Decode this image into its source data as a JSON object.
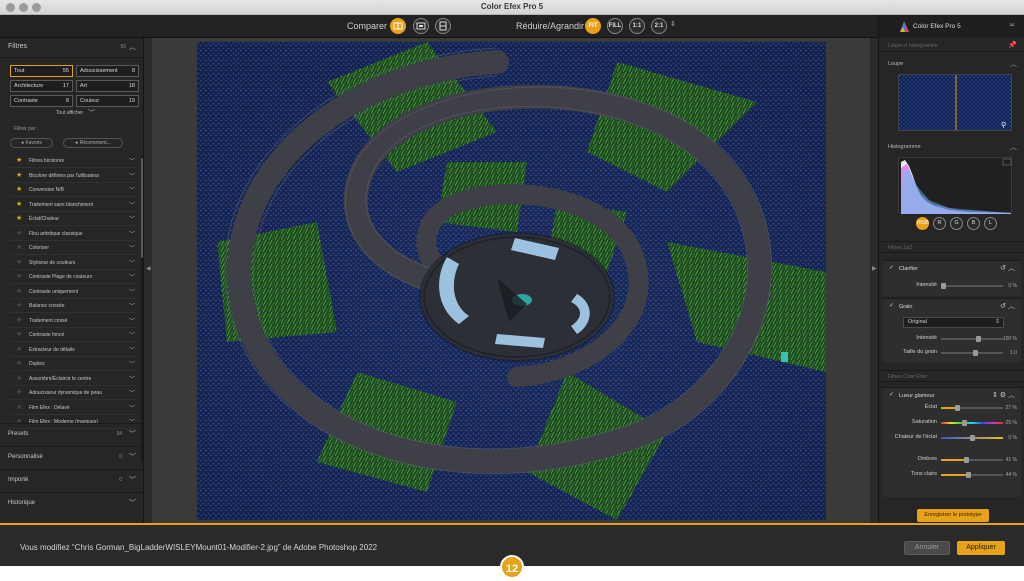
{
  "window": {
    "title": "Color Efex Pro 5"
  },
  "toolbar": {
    "compare_label": "Comparer",
    "resize_label": "Réduire/Agrandir",
    "zoom_buttons": [
      "FIT",
      "FILL",
      "1:1",
      "2:1"
    ]
  },
  "left_panel": {
    "filters": {
      "title": "Filtres",
      "count": "55",
      "categories": [
        {
          "label": "Tout",
          "count": "55"
        },
        {
          "label": "Adoucissement",
          "count": "8"
        },
        {
          "label": "Architecture",
          "count": "17"
        },
        {
          "label": "Art",
          "count": "18"
        },
        {
          "label": "Contraste",
          "count": "8"
        },
        {
          "label": "Couleur",
          "count": "19"
        }
      ],
      "show_all": "Tout afficher",
      "filter_by": "Filtrer par :",
      "favorites": "Favoris",
      "recent": "Récemment...",
      "items": [
        {
          "label": "Filtres bicolores",
          "favorite": true
        },
        {
          "label": "Bicolore définies par l'utilisateur",
          "favorite": true
        },
        {
          "label": "Conversion N/B",
          "favorite": true
        },
        {
          "label": "Traitement sans blanchiment",
          "favorite": true
        },
        {
          "label": "Éclat/Chaleur",
          "favorite": true
        },
        {
          "label": "Flou artistique classique",
          "favorite": false
        },
        {
          "label": "Coloriser",
          "favorite": false
        },
        {
          "label": "Styliseur de couleurs",
          "favorite": false
        },
        {
          "label": "Contraste Plage de couleurs",
          "favorite": false
        },
        {
          "label": "Contraste uniquement",
          "favorite": false
        },
        {
          "label": "Balance croisée",
          "favorite": false
        },
        {
          "label": "Traitement croisé",
          "favorite": false
        },
        {
          "label": "Contraste foncé",
          "favorite": false
        },
        {
          "label": "Extracteur de détails",
          "favorite": false
        },
        {
          "label": "Duplex",
          "favorite": false
        },
        {
          "label": "Assombrir/Éclaircir le centre",
          "favorite": false
        },
        {
          "label": "Adoucisseur dynamique de peau",
          "favorite": false
        },
        {
          "label": "Film Efex : Délavé",
          "favorite": false
        },
        {
          "label": "Film Efex : Moderne (marques)",
          "favorite": false
        }
      ]
    },
    "presets": {
      "title": "Presets",
      "count": "34"
    },
    "personalise": {
      "title": "Personnalisé",
      "count": "0"
    },
    "importe": {
      "title": "Importé",
      "count": "0"
    },
    "historique": {
      "title": "Historique"
    }
  },
  "right_panel": {
    "brand": "Color Efex Pro 5",
    "loupe_histo_title": "Loupe et histogramme",
    "loupe_title": "Loupe",
    "histogram_title": "Histogramme",
    "channels": [
      "RGB",
      "R",
      "G",
      "B",
      "L"
    ],
    "stack_title": "Filtres 1st2",
    "clarity": {
      "title": "Clarifier",
      "intensity_label": "Intensité",
      "intensity_value": "0 %",
      "intensity_level": 0
    },
    "grain": {
      "title": "Grain",
      "select_value": "Original",
      "intensity_label": "Intensité",
      "intensity_value": "100 %",
      "intensity_level": 0.6,
      "size_label": "Taille du grain",
      "size_value": "1.0",
      "size_level": 0.55
    },
    "color_filters_title": "Filtres Color Filter",
    "glow": {
      "title": "Lueur glamour",
      "params": [
        {
          "label": "Éclat",
          "value": "27 %",
          "level": 0.27,
          "color": "#e5a21a"
        },
        {
          "label": "Saturation",
          "value": "-25 %",
          "level": 0.38,
          "color": "rainbow"
        },
        {
          "label": "Chaleur de l'éclat",
          "value": "0 %",
          "level": 0.5,
          "color": "#3a57d6"
        },
        {
          "label": "Ombres",
          "value": "41 %",
          "level": 0.41,
          "color": "#e5a21a"
        },
        {
          "label": "Tons clairs",
          "value": "44 %",
          "level": 0.44,
          "color": "#e5a21a"
        }
      ]
    },
    "save_preset": "Enregistrer le prototype"
  },
  "bottom": {
    "message": "Vous modifiez “Chris Gorman_BigLadderWISLEYMount01-Modifier-2.jpg” de Adobe Photoshop 2022",
    "cancel": "Annuler",
    "apply": "Appliquer",
    "badge": "12"
  },
  "colors": {
    "accent": "#e5a21a",
    "panel": "#262626",
    "canvas": "#3a3a3a"
  }
}
